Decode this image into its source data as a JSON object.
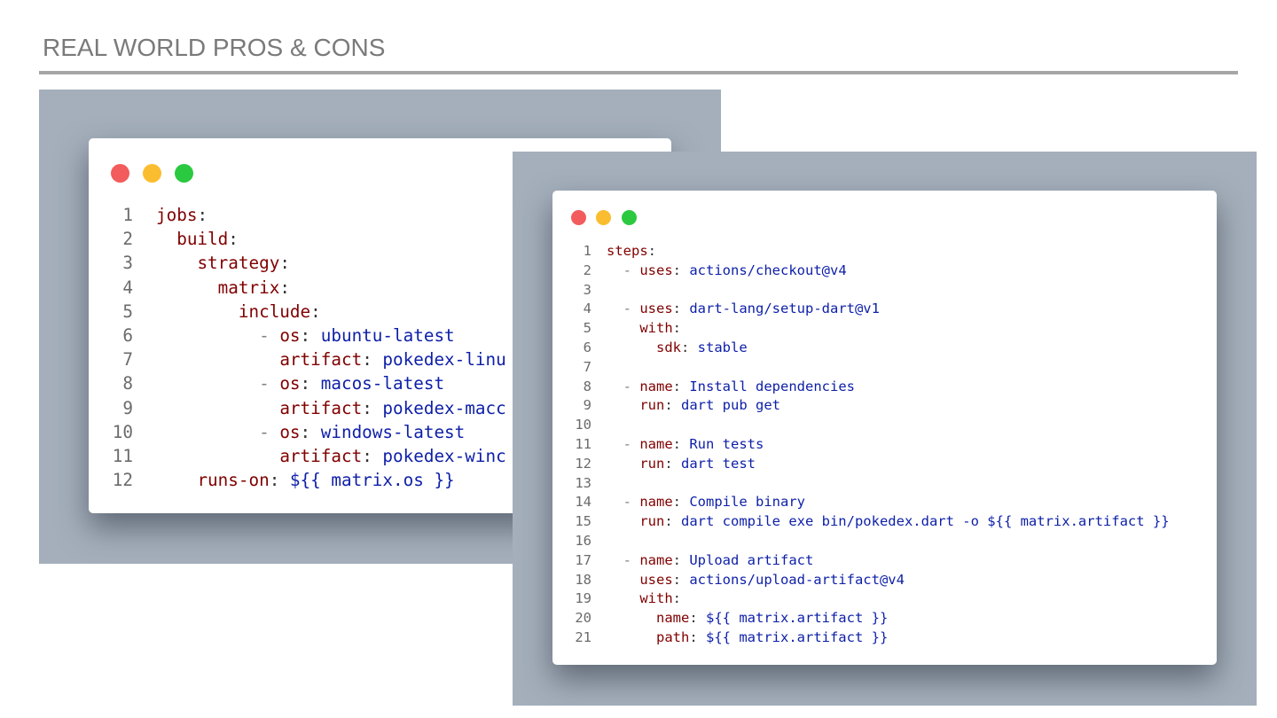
{
  "slide": {
    "title": "REAL WORLD PROS & CONS"
  },
  "colors": {
    "key": "#800000",
    "value": "#0d1fa8",
    "line_number": "#6b6b6b",
    "panel_background": "#a4afbb",
    "title_text": "#7a7a7a"
  },
  "window_controls": {
    "icons": [
      "close-dot-icon",
      "minimize-dot-icon",
      "maximize-dot-icon"
    ],
    "colors": [
      "#f25c5c",
      "#fbbd30",
      "#2bc940"
    ]
  },
  "left_snippet": {
    "lines": [
      {
        "n": "1",
        "indent": "",
        "dash": "",
        "key": "jobs",
        "colon": ":",
        "value": ""
      },
      {
        "n": "2",
        "indent": "  ",
        "dash": "",
        "key": "build",
        "colon": ":",
        "value": ""
      },
      {
        "n": "3",
        "indent": "    ",
        "dash": "",
        "key": "strategy",
        "colon": ":",
        "value": ""
      },
      {
        "n": "4",
        "indent": "      ",
        "dash": "",
        "key": "matrix",
        "colon": ":",
        "value": ""
      },
      {
        "n": "5",
        "indent": "        ",
        "dash": "",
        "key": "include",
        "colon": ":",
        "value": ""
      },
      {
        "n": "6",
        "indent": "          ",
        "dash": "- ",
        "key": "os",
        "colon": ": ",
        "value": "ubuntu-latest"
      },
      {
        "n": "7",
        "indent": "            ",
        "dash": "",
        "key": "artifact",
        "colon": ": ",
        "value": "pokedex-linu"
      },
      {
        "n": "8",
        "indent": "          ",
        "dash": "- ",
        "key": "os",
        "colon": ": ",
        "value": "macos-latest"
      },
      {
        "n": "9",
        "indent": "            ",
        "dash": "",
        "key": "artifact",
        "colon": ": ",
        "value": "pokedex-macc"
      },
      {
        "n": "10",
        "indent": "          ",
        "dash": "- ",
        "key": "os",
        "colon": ": ",
        "value": "windows-latest"
      },
      {
        "n": "11",
        "indent": "            ",
        "dash": "",
        "key": "artifact",
        "colon": ": ",
        "value": "pokedex-winc"
      },
      {
        "n": "12",
        "indent": "    ",
        "dash": "",
        "key": "runs-on",
        "colon": ": ",
        "value": "${{ matrix.os }}"
      }
    ]
  },
  "right_snippet": {
    "lines": [
      {
        "n": "1",
        "indent": "",
        "dash": "",
        "key": "steps",
        "colon": ":",
        "value": ""
      },
      {
        "n": "2",
        "indent": "  ",
        "dash": "- ",
        "key": "uses",
        "colon": ": ",
        "value": "actions/checkout@v4"
      },
      {
        "n": "3",
        "indent": "",
        "dash": "",
        "key": "",
        "colon": "",
        "value": ""
      },
      {
        "n": "4",
        "indent": "  ",
        "dash": "- ",
        "key": "uses",
        "colon": ": ",
        "value": "dart-lang/setup-dart@v1"
      },
      {
        "n": "5",
        "indent": "    ",
        "dash": "",
        "key": "with",
        "colon": ":",
        "value": ""
      },
      {
        "n": "6",
        "indent": "      ",
        "dash": "",
        "key": "sdk",
        "colon": ": ",
        "value": "stable"
      },
      {
        "n": "7",
        "indent": "",
        "dash": "",
        "key": "",
        "colon": "",
        "value": ""
      },
      {
        "n": "8",
        "indent": "  ",
        "dash": "- ",
        "key": "name",
        "colon": ": ",
        "value": "Install dependencies"
      },
      {
        "n": "9",
        "indent": "    ",
        "dash": "",
        "key": "run",
        "colon": ": ",
        "value": "dart pub get"
      },
      {
        "n": "10",
        "indent": "",
        "dash": "",
        "key": "",
        "colon": "",
        "value": ""
      },
      {
        "n": "11",
        "indent": "  ",
        "dash": "- ",
        "key": "name",
        "colon": ": ",
        "value": "Run tests"
      },
      {
        "n": "12",
        "indent": "    ",
        "dash": "",
        "key": "run",
        "colon": ": ",
        "value": "dart test"
      },
      {
        "n": "13",
        "indent": "",
        "dash": "",
        "key": "",
        "colon": "",
        "value": ""
      },
      {
        "n": "14",
        "indent": "  ",
        "dash": "- ",
        "key": "name",
        "colon": ": ",
        "value": "Compile binary"
      },
      {
        "n": "15",
        "indent": "    ",
        "dash": "",
        "key": "run",
        "colon": ": ",
        "value": "dart compile exe bin/pokedex.dart -o ${{ matrix.artifact }}"
      },
      {
        "n": "16",
        "indent": "",
        "dash": "",
        "key": "",
        "colon": "",
        "value": ""
      },
      {
        "n": "17",
        "indent": "  ",
        "dash": "- ",
        "key": "name",
        "colon": ": ",
        "value": "Upload artifact"
      },
      {
        "n": "18",
        "indent": "    ",
        "dash": "",
        "key": "uses",
        "colon": ": ",
        "value": "actions/upload-artifact@v4"
      },
      {
        "n": "19",
        "indent": "    ",
        "dash": "",
        "key": "with",
        "colon": ":",
        "value": ""
      },
      {
        "n": "20",
        "indent": "      ",
        "dash": "",
        "key": "name",
        "colon": ": ",
        "value": "${{ matrix.artifact }}"
      },
      {
        "n": "21",
        "indent": "      ",
        "dash": "",
        "key": "path",
        "colon": ": ",
        "value": "${{ matrix.artifact }}"
      }
    ]
  }
}
